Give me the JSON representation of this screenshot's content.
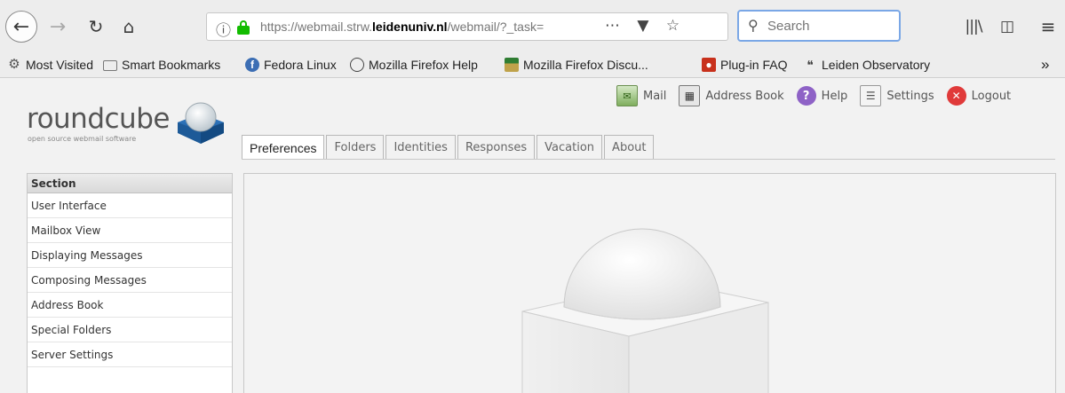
{
  "browser": {
    "url": {
      "prefix": "https://webmail.strw.",
      "domain": "leidenuniv.nl",
      "path": "/webmail/?_task="
    },
    "search": {
      "placeholder": "Search"
    },
    "icons": {
      "back": "back-arrow-icon",
      "forward": "forward-arrow-icon",
      "reload": "reload-icon",
      "home": "home-icon",
      "page_actions": "more-dots-icon",
      "pocket": "pocket-icon",
      "bookmark": "star-icon",
      "download": "download-icon",
      "library": "library-icon",
      "sidebar": "sidebar-icon",
      "menu": "hamburger-menu-icon"
    },
    "bookmarks": [
      {
        "label": "Most Visited",
        "icon": "gear-icon"
      },
      {
        "label": "Smart Bookmarks",
        "icon": "folder-icon"
      },
      {
        "label": "Fedora Linux",
        "icon": "fedora-icon"
      },
      {
        "label": "Mozilla Firefox Help",
        "icon": "globe-icon"
      },
      {
        "label": "Mozilla Firefox Discu...",
        "icon": "zine-icon"
      },
      {
        "label": "Plug-in FAQ",
        "icon": "plugin-icon"
      },
      {
        "label": "Leiden Observatory",
        "icon": "rss-icon"
      }
    ]
  },
  "app": {
    "logo": {
      "name": "roundcube",
      "tagline": "open source webmail software"
    },
    "topnav": [
      {
        "label": "Mail",
        "icon": "mail-icon"
      },
      {
        "label": "Address Book",
        "icon": "address-book-icon"
      },
      {
        "label": "Help",
        "icon": "help-icon"
      },
      {
        "label": "Settings",
        "icon": "settings-icon"
      },
      {
        "label": "Logout",
        "icon": "logout-icon"
      }
    ],
    "tabs": [
      {
        "label": "Preferences",
        "active": true
      },
      {
        "label": "Folders",
        "active": false
      },
      {
        "label": "Identities",
        "active": false
      },
      {
        "label": "Responses",
        "active": false
      },
      {
        "label": "Vacation",
        "active": false
      },
      {
        "label": "About",
        "active": false
      }
    ],
    "sections": {
      "header": "Section",
      "items": [
        "User Interface",
        "Mailbox View",
        "Displaying Messages",
        "Composing Messages",
        "Address Book",
        "Special Folders",
        "Server Settings"
      ]
    }
  },
  "colors": {
    "secure_lock": "#12bc00",
    "search_focus": "#7aa7e6",
    "help_purple": "#8e62c6",
    "logout_red": "#e03a3a"
  }
}
